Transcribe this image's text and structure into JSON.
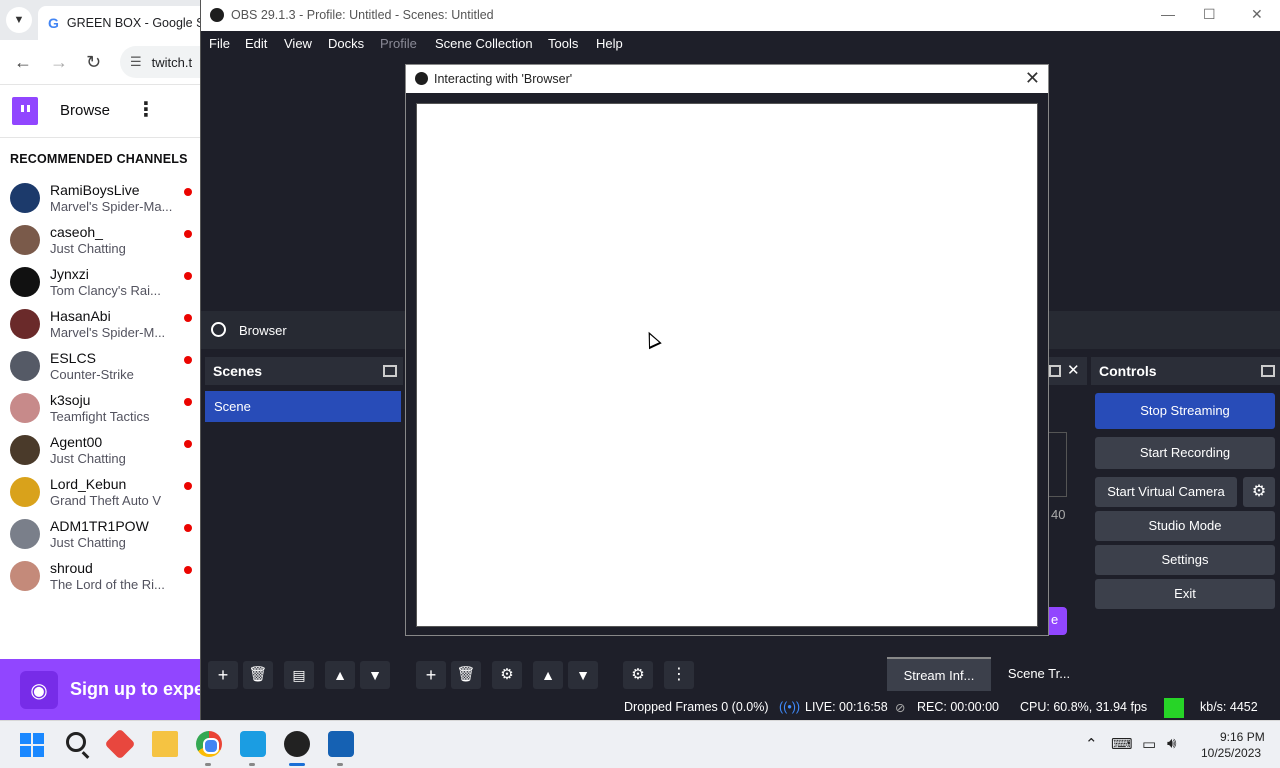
{
  "chrome": {
    "tab_title": "GREEN BOX - Google Se",
    "address": "twitch.t",
    "browse_label": "Browse",
    "recommended_heading": "RECOMMENDED CHANNELS",
    "channels": [
      {
        "name": "RamiBoysLive",
        "game": "Marvel's Spider-Ma...",
        "avatar_color": "#1c3a6b"
      },
      {
        "name": "caseoh_",
        "game": "Just Chatting",
        "avatar_color": "#7a5a4a"
      },
      {
        "name": "Jynxzi",
        "game": "Tom Clancy's Rai...",
        "avatar_color": "#111111"
      },
      {
        "name": "HasanAbi",
        "game": "Marvel's Spider-M...",
        "avatar_color": "#6a2a2a"
      },
      {
        "name": "ESLCS",
        "game": "Counter-Strike",
        "avatar_color": "#555a66"
      },
      {
        "name": "k3soju",
        "game": "Teamfight Tactics",
        "avatar_color": "#c78a8a"
      },
      {
        "name": "Agent00",
        "game": "Just Chatting",
        "avatar_color": "#4a3a2a"
      },
      {
        "name": "Lord_Kebun",
        "game": "Grand Theft Auto V",
        "avatar_color": "#d9a21b"
      },
      {
        "name": "ADM1TR1POW",
        "game": "Just Chatting",
        "avatar_color": "#7a7f8a"
      },
      {
        "name": "shroud",
        "game": "The Lord of the Ri...",
        "avatar_color": "#c48a7a"
      }
    ],
    "signup_text": "Sign up to expe"
  },
  "obs": {
    "window_title": "OBS 29.1.3 - Profile: Untitled - Scenes: Untitled",
    "menu": [
      "File",
      "Edit",
      "View",
      "Docks",
      "Profile",
      "Scene Collection",
      "Tools",
      "Help"
    ],
    "source_name": "Browser",
    "scenes_title": "Scenes",
    "scene_item": "Scene",
    "controls_title": "Controls",
    "controls": {
      "stop_streaming": "Stop Streaming",
      "start_recording": "Start Recording",
      "start_virtual_camera": "Start Virtual Camera",
      "studio_mode": "Studio Mode",
      "settings": "Settings",
      "exit": "Exit"
    },
    "mid_dock_number": "40",
    "mid_dock_button_char": "e",
    "bottom_tabs": {
      "stream_info": "Stream Inf...",
      "scene_transitions": "Scene Tr..."
    },
    "status": {
      "dropped_frames": "Dropped Frames 0 (0.0%)",
      "live": "LIVE: 00:16:58",
      "rec": "REC: 00:00:00",
      "cpu": "CPU: 60.8%, 31.94 fps",
      "bitrate": "kb/s: 4452"
    }
  },
  "dialog": {
    "title": "Interacting with 'Browser'",
    "close_glyph": "✕"
  },
  "taskbar": {
    "time": "9:16 PM",
    "date": "10/25/2023"
  }
}
